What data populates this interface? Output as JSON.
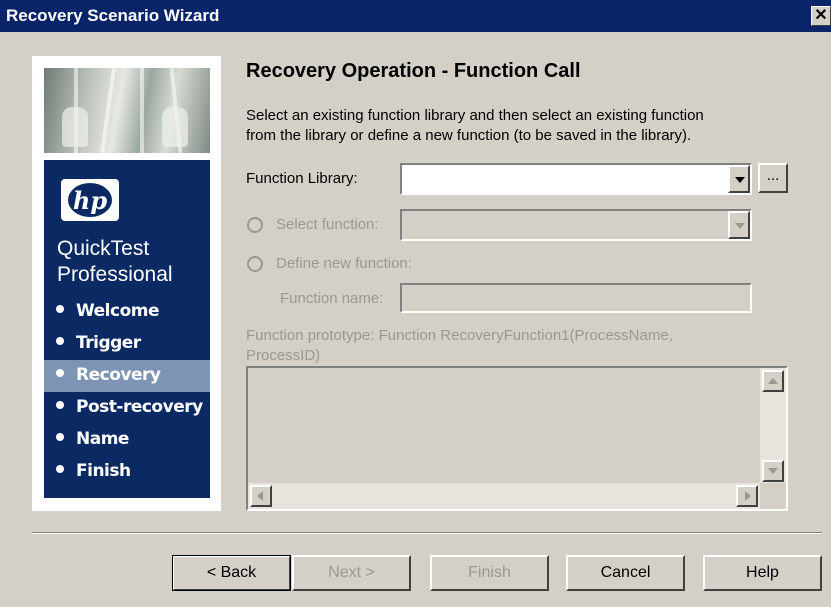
{
  "window": {
    "title": "Recovery Scenario Wizard",
    "close_symbol": "✕"
  },
  "sidebar": {
    "logo_text": "hp",
    "product_line1": "QuickTest",
    "product_line2": "Professional",
    "steps": [
      {
        "label": "Welcome"
      },
      {
        "label": "Trigger"
      },
      {
        "label": "Recovery"
      },
      {
        "label": "Post-recovery"
      },
      {
        "label": "Name"
      },
      {
        "label": "Finish"
      }
    ],
    "active_step": "Recovery"
  },
  "page": {
    "heading": "Recovery Operation - Function Call",
    "instruction_line1": "Select an existing function library and then select an existing function",
    "instruction_line2": "from the library or define a new function (to be saved in the library).",
    "function_library_label": "Function Library:",
    "function_library_value": "",
    "browse_label": "...",
    "select_function_label": "Select function:",
    "select_function_value": "",
    "define_new_label": "Define new function:",
    "function_name_label": "Function name:",
    "function_name_value": "",
    "prototype_line1": "Function prototype: Function RecoveryFunction1(ProcessName,",
    "prototype_line2": "ProcessID)",
    "function_body": ""
  },
  "buttons": {
    "back": "< Back",
    "next": "Next >",
    "finish": "Finish",
    "cancel": "Cancel",
    "help": "Help"
  },
  "colors": {
    "title_bar": "#0a246a",
    "sidebar_nav": "#0b2a63",
    "active_step": "#7e94b5",
    "dialog_bg": "#d4d0c8",
    "disabled_text": "#9a988f"
  }
}
